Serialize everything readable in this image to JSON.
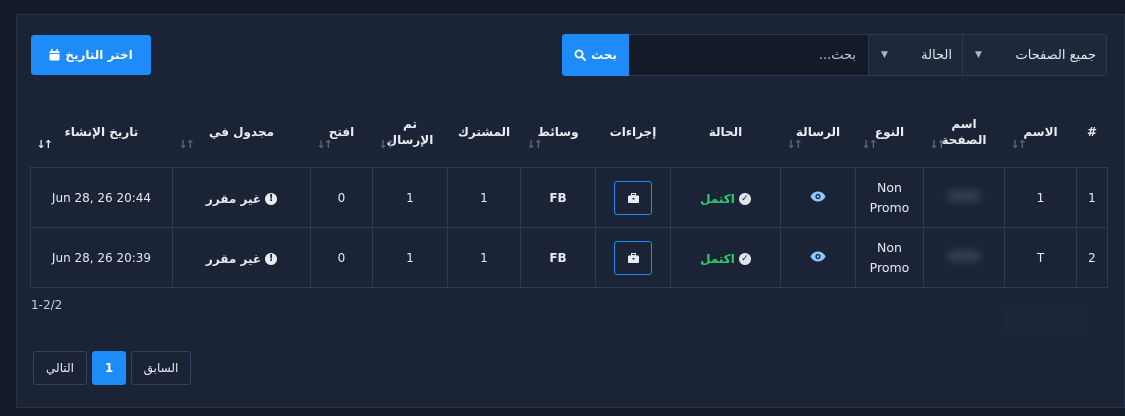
{
  "toolbar": {
    "date_button": "اختر التاريخ",
    "search_button": "بحث",
    "search_placeholder": "بحث...",
    "status_select": "الحالة",
    "pages_select": "جميع الصفحات"
  },
  "table": {
    "headers": [
      "#",
      "الاسم",
      "اسم الصفحة",
      "النوع",
      "الرسالة",
      "الحالة",
      "إجراءات",
      "وسائط",
      "المشترك",
      "تم الإرسال",
      "افتح",
      "مجدول في",
      "تاريخ الإنشاء"
    ],
    "rows": [
      {
        "num": "1",
        "name": "1",
        "type_line1": "Non",
        "type_line2": "Promo",
        "status": "اكتمل",
        "media": "FB",
        "subscriber": "1",
        "sent": "1",
        "opened": "0",
        "scheduled": "غير مقرر",
        "created": "Jun 28, 26 20:44"
      },
      {
        "num": "2",
        "name": "T",
        "type_line1": "Non",
        "type_line2": "Promo",
        "status": "اكتمل",
        "media": "FB",
        "subscriber": "1",
        "sent": "1",
        "opened": "0",
        "scheduled": "غير مقرر",
        "created": "Jun 28, 26 20:39"
      }
    ]
  },
  "footer": {
    "count": "1-2/2",
    "next": "التالي",
    "current_page": "1",
    "previous": "السابق"
  },
  "colors": {
    "accent": "#1d8cf8",
    "success": "#2ecc71",
    "background": "#141b2b",
    "panel": "#1a2436"
  },
  "icons": {
    "date_button": "calendar-icon",
    "search_button": "search-icon",
    "message": "eye-icon",
    "status": "check-circle-icon",
    "actions": "briefcase-icon",
    "scheduled": "exclamation-circle-icon",
    "sort": "sort-arrows-icon"
  }
}
